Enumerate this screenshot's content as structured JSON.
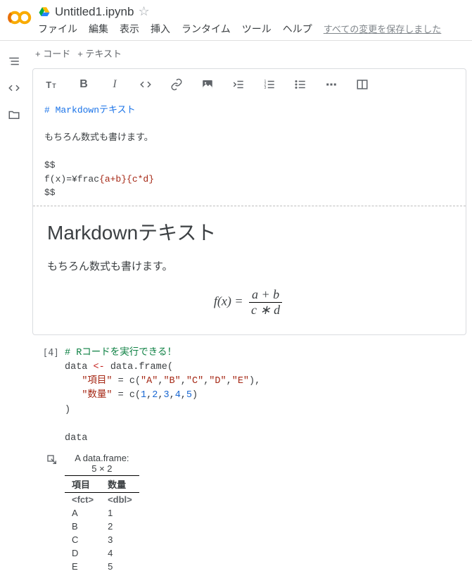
{
  "header": {
    "title": "Untitled1.ipynb",
    "menu": [
      "ファイル",
      "編集",
      "表示",
      "挿入",
      "ランタイム",
      "ツール",
      "ヘルプ"
    ],
    "save_status": "すべての変更を保存しました"
  },
  "add_bar": {
    "code": "+ コード",
    "text": "+ テキスト"
  },
  "md_cell": {
    "source_lines": {
      "l1_prefix": "# ",
      "l1_text": "Markdownテキスト",
      "l2": "",
      "l3": "もちろん数式も書けます。",
      "l4": "",
      "l5": "$$",
      "l6_a": "f(x)=¥frac",
      "l6_b": "{a+b}",
      "l6_c": "{c*d}",
      "l7": "$$"
    },
    "preview": {
      "h1": "Markdownテキスト",
      "p": "もちろん数式も書けます。",
      "formula": {
        "lhs": "f(x) = ",
        "num": "a + b",
        "den": "c ∗ d"
      }
    }
  },
  "code_cell": {
    "prompt": "[4]",
    "lines": {
      "l1_comment": "# Rコードを実行できる！",
      "l2_a": "data ",
      "l2_op": "<-",
      "l2_b": " data.frame(",
      "l3_a": "   ",
      "l3_k": "\"項目\"",
      "l3_b": " = c(",
      "l3_v1": "\"A\"",
      "l3_v2": "\"B\"",
      "l3_v3": "\"C\"",
      "l3_v4": "\"D\"",
      "l3_v5": "\"E\"",
      "l3_c": "),",
      "l4_a": "   ",
      "l4_k": "\"数量\"",
      "l4_b": " = c(",
      "l4_v1": "1",
      "l4_v2": "2",
      "l4_v3": "3",
      "l4_v4": "4",
      "l4_v5": "5",
      "l4_c": ")",
      "l5": ")",
      "l6": "",
      "l7": "data"
    }
  },
  "output": {
    "caption": "A data.frame:",
    "dim": "5 × 2",
    "columns": [
      "項目",
      "数量"
    ],
    "types": [
      "<fct>",
      "<dbl>"
    ],
    "rows": [
      [
        "A",
        "1"
      ],
      [
        "B",
        "2"
      ],
      [
        "C",
        "3"
      ],
      [
        "D",
        "4"
      ],
      [
        "E",
        "5"
      ]
    ]
  }
}
